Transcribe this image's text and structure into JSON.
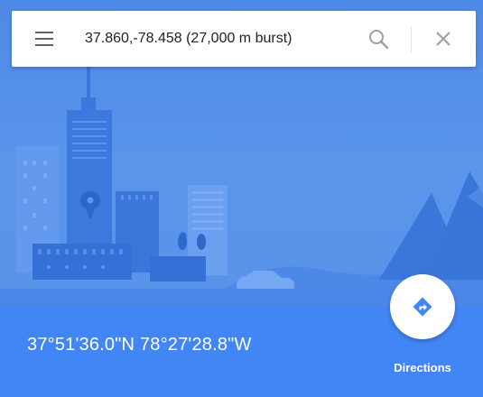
{
  "search": {
    "query": "37.860,-78.458 (27,000 m burst)"
  },
  "place": {
    "coordinates_dms": "37°51'36.0\"N 78°27'28.8\"W"
  },
  "actions": {
    "directions_label": "Directions"
  },
  "icons": {
    "menu": "hamburger-menu-icon",
    "search": "magnifier-icon",
    "clear": "close-icon",
    "directions": "directions-arrow-icon"
  },
  "colors": {
    "accent": "#4285f4",
    "hero_background": "#4d89e6",
    "directions_icon": "#4285f4",
    "icon_gray": "#9aa0a6"
  }
}
